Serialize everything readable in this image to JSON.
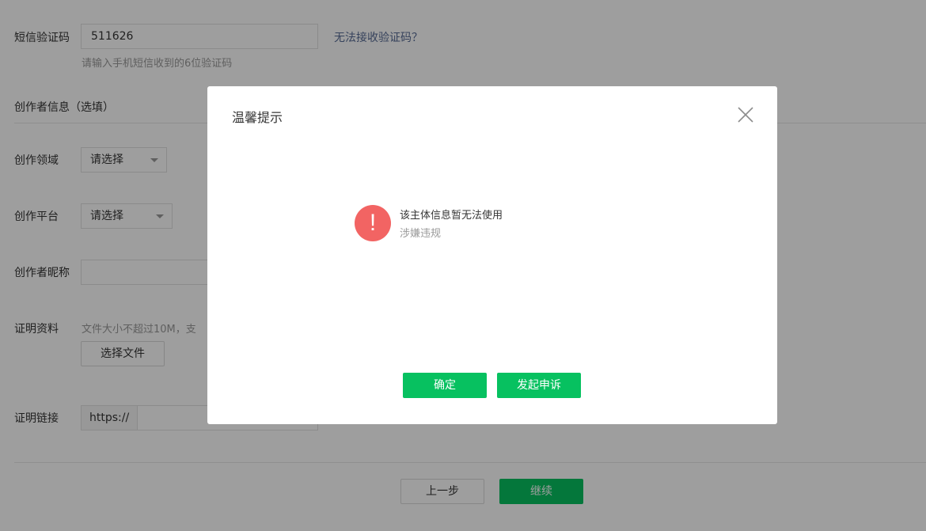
{
  "form": {
    "sms_label": "短信验证码",
    "sms_value": "511626",
    "sms_help": "无法接收验证码？",
    "sms_hint": "请输入手机短信收到的6位验证码",
    "creator_section": "创作者信息（选填）",
    "field_label": "创作领域",
    "field_select": "请选择",
    "platform_label": "创作平台",
    "platform_select": "请选择",
    "nickname_label": "创作者昵称",
    "proof_label": "证明资料",
    "proof_hint": "文件大小不超过10M，支",
    "choose_file": "选择文件",
    "link_label": "证明链接",
    "link_prefix": "https://",
    "prev_button": "上一步",
    "continue_button": "继续"
  },
  "dialog": {
    "title": "温馨提示",
    "icon_glyph": "!",
    "message": "该主体信息暂无法使用",
    "reason": "涉嫌违规",
    "confirm_button": "确定",
    "appeal_button": "发起申诉"
  },
  "colors": {
    "primary_green": "#07c160",
    "warning_red": "#f26463",
    "link_blue": "#576b95"
  }
}
